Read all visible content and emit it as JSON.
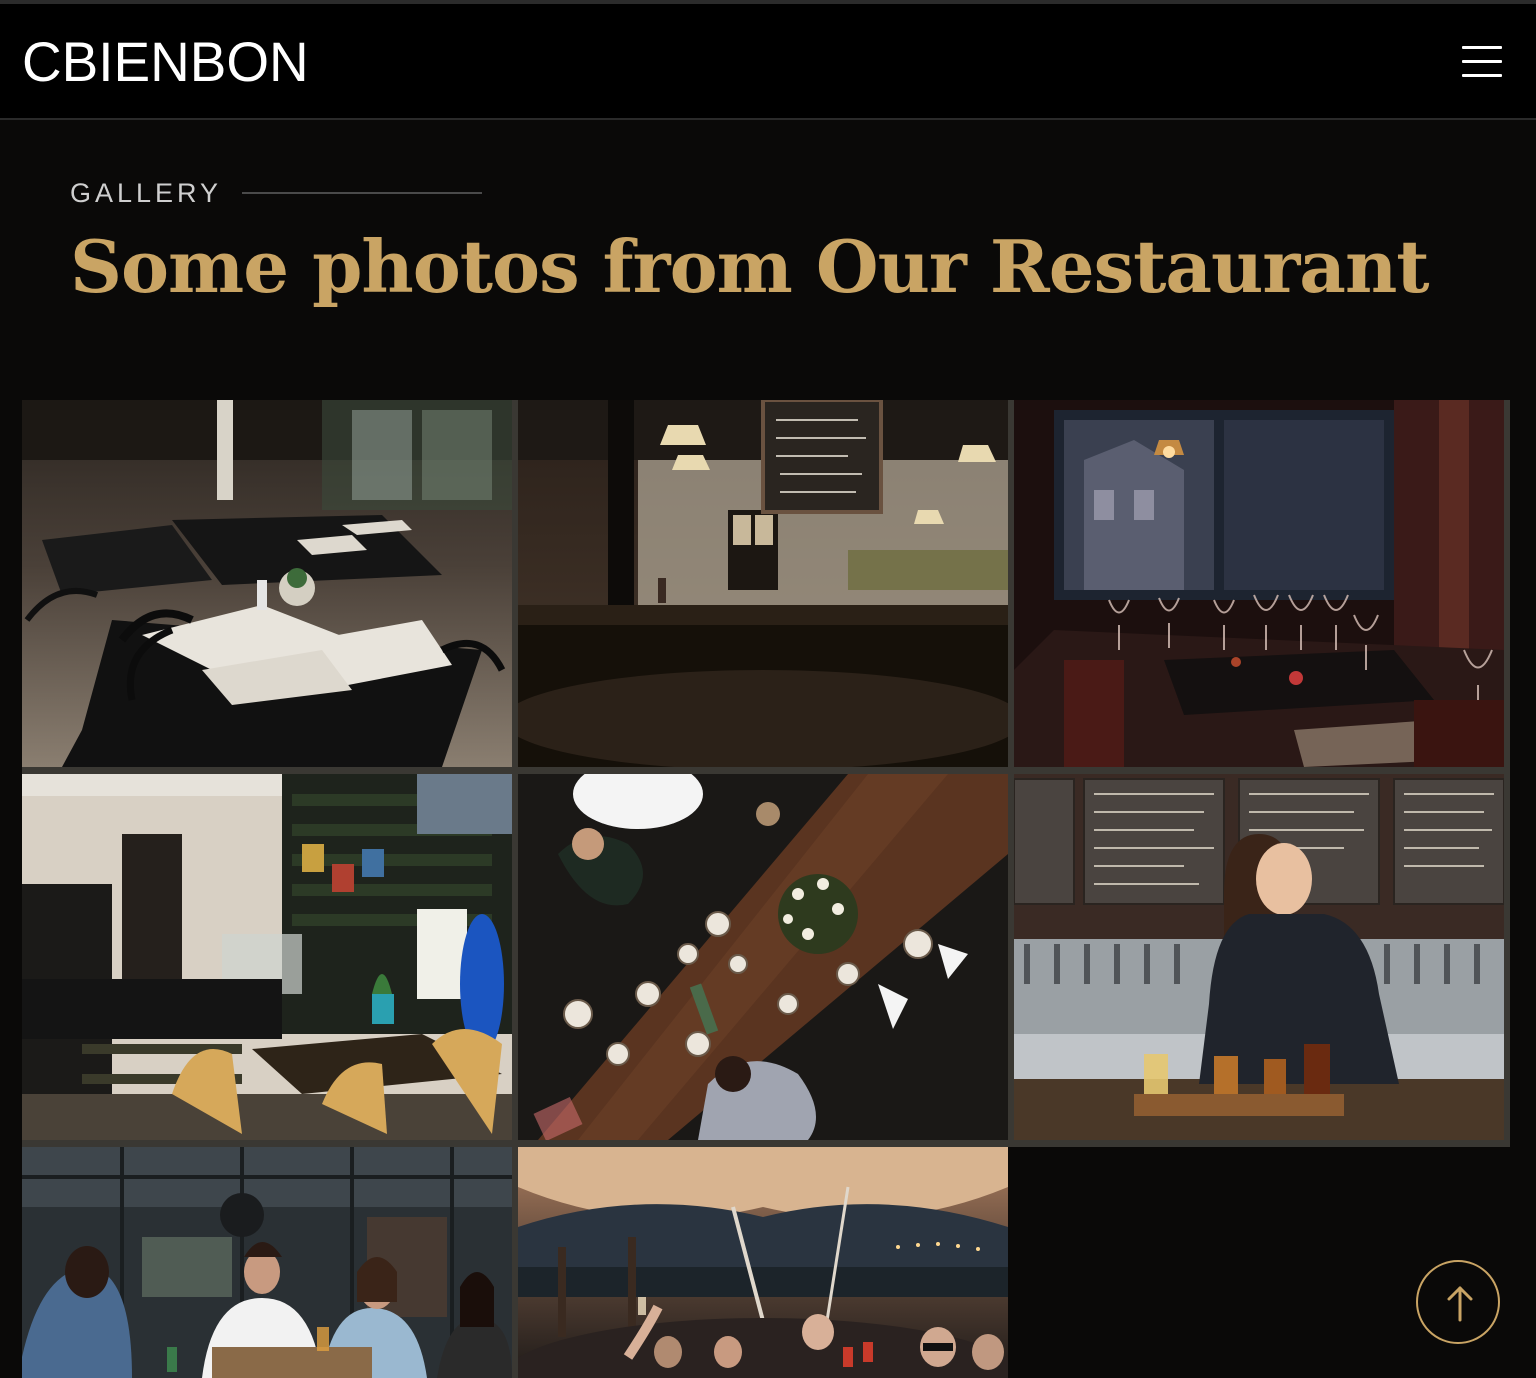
{
  "header": {
    "logo": "CBIENBON",
    "menu_icon": "hamburger-menu-icon"
  },
  "section": {
    "eyebrow": "GALLERY",
    "title": "Some photos from Our Restaurant"
  },
  "gallery": {
    "photos": [
      {
        "subject": "dining room with black tables and menus"
      },
      {
        "subject": "dim bistro interior with chalkboard menu"
      },
      {
        "subject": "dining tables with wine glasses by window"
      },
      {
        "subject": "cafe counter with drink fridges and surfboard"
      },
      {
        "subject": "overhead view of wooden table with meal"
      },
      {
        "subject": "woman at bar with tap wall and flight of beers"
      },
      {
        "subject": "friends laughing on outdoor terrace"
      },
      {
        "subject": "guests toasting under evening tent"
      }
    ]
  },
  "scroll_top": {
    "icon": "arrow-up-icon"
  },
  "colors": {
    "background": "#0a0908",
    "header": "#000000",
    "accent_gold": "#c9a464",
    "eyebrow_text": "#cfcfcf"
  }
}
